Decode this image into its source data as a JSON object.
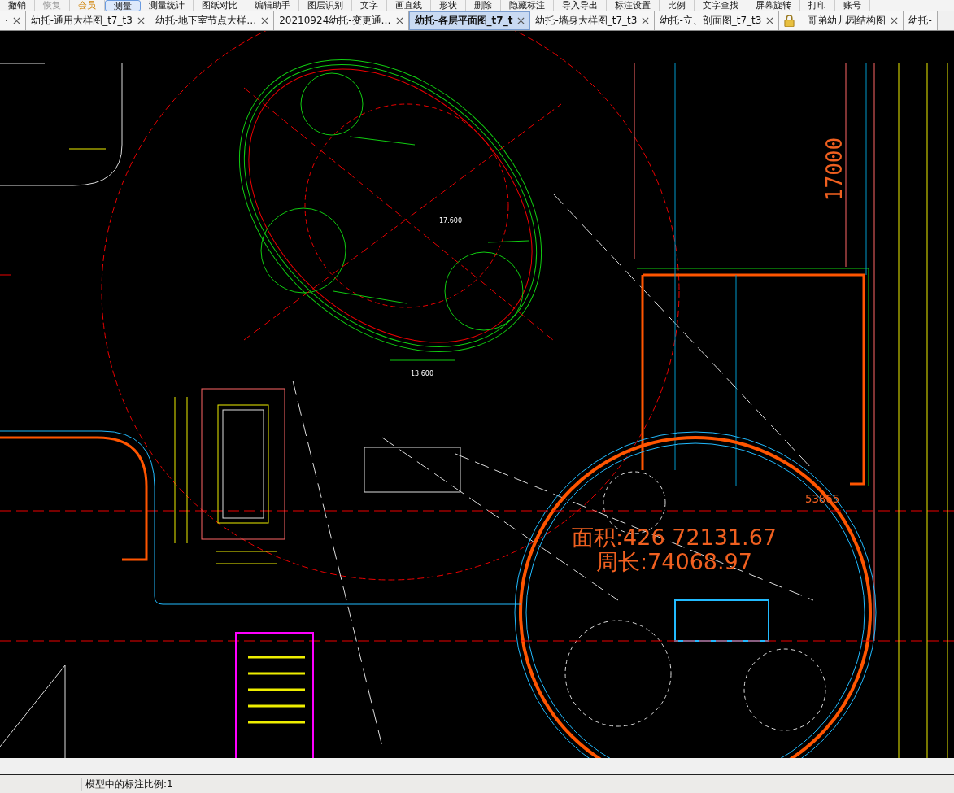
{
  "toolbar": [
    {
      "label": "撤销",
      "kind": "normal",
      "selected": false
    },
    {
      "label": "恢复",
      "kind": "disabled",
      "selected": false
    },
    {
      "label": "会员",
      "kind": "vip",
      "selected": false
    },
    {
      "label": "测量",
      "kind": "normal",
      "selected": true
    },
    {
      "label": "测量统计",
      "kind": "normal",
      "selected": false
    },
    {
      "label": "图纸对比",
      "kind": "normal",
      "selected": false
    },
    {
      "label": "编辑助手",
      "kind": "normal",
      "selected": false
    },
    {
      "label": "图层识别",
      "kind": "normal",
      "selected": false
    },
    {
      "label": "文字",
      "kind": "normal",
      "selected": false
    },
    {
      "label": "画直线",
      "kind": "normal",
      "selected": false
    },
    {
      "label": "形状",
      "kind": "normal",
      "selected": false
    },
    {
      "label": "删除",
      "kind": "normal",
      "selected": false
    },
    {
      "label": "隐藏标注",
      "kind": "normal",
      "selected": false
    },
    {
      "label": "导入导出",
      "kind": "normal",
      "selected": false
    },
    {
      "label": "标注设置",
      "kind": "normal",
      "selected": false
    },
    {
      "label": "比例",
      "kind": "normal",
      "selected": false
    },
    {
      "label": "文字查找",
      "kind": "normal",
      "selected": false
    },
    {
      "label": "屏幕旋转",
      "kind": "normal",
      "selected": false
    },
    {
      "label": "打印",
      "kind": "normal",
      "selected": false
    },
    {
      "label": "账号",
      "kind": "normal",
      "selected": false
    }
  ],
  "tabs": [
    {
      "label": "·",
      "selected": false,
      "locked": false,
      "closable": true
    },
    {
      "label": "幼托-通用大样图_t7_t3",
      "selected": false,
      "locked": false,
      "closable": true
    },
    {
      "label": "幼托-地下室节点大样…",
      "selected": false,
      "locked": false,
      "closable": true
    },
    {
      "label": "20210924幼托-变更通…",
      "selected": false,
      "locked": false,
      "closable": true
    },
    {
      "label": "幼托-各层平面图_t7_t",
      "selected": true,
      "locked": false,
      "closable": true
    },
    {
      "label": "幼托-墙身大样图_t7_t3",
      "selected": false,
      "locked": false,
      "closable": true
    },
    {
      "label": "幼托-立、剖面图_t7_t3",
      "selected": false,
      "locked": false,
      "closable": true
    },
    {
      "label": "哥弟幼儿园结构图",
      "selected": false,
      "locked": true,
      "closable": true
    },
    {
      "label": "幼托-",
      "selected": false,
      "locked": false,
      "closable": false
    }
  ],
  "drawing": {
    "dimension_vertical": "17000",
    "dimension": "53865",
    "area": "面积:426 72131.67",
    "perimeter": "周长:74068.97",
    "elevations": [
      "17.600",
      "13.600"
    ]
  },
  "status_bar": {
    "scale": "模型中的标注比例:1"
  }
}
